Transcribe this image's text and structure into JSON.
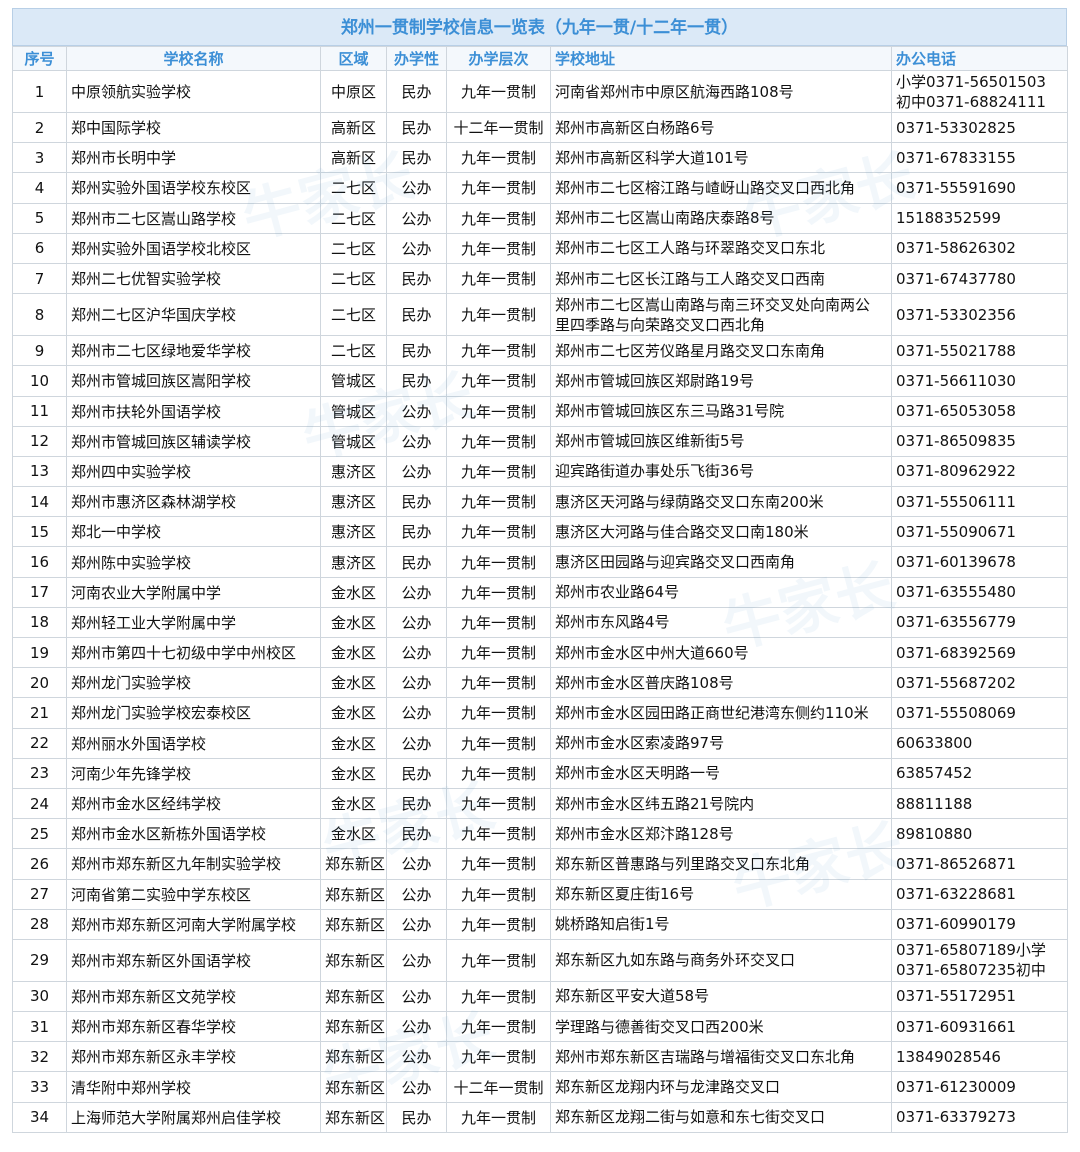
{
  "title": "郑州一贯制学校信息一览表（九年一贯/十二年一贯）",
  "columns": [
    "序号",
    "学校名称",
    "区域",
    "办学性",
    "办学层次",
    "学校地址",
    "办公电话"
  ],
  "rows": [
    {
      "no": "1",
      "name": "中原领航实验学校",
      "district": "中原区",
      "type": "民办",
      "level": "九年一贯制",
      "address": [
        "河南省郑州市中原区航海西路108号"
      ],
      "phone": [
        "小学0371-56501503",
        "初中0371-68824111"
      ]
    },
    {
      "no": "2",
      "name": "郑中国际学校",
      "district": "高新区",
      "type": "民办",
      "level": "十二年一贯制",
      "address": [
        "郑州市高新区白杨路6号"
      ],
      "phone": [
        "0371-53302825"
      ]
    },
    {
      "no": "3",
      "name": "郑州市长明中学",
      "district": "高新区",
      "type": "民办",
      "level": "九年一贯制",
      "address": [
        "郑州市高新区科学大道101号"
      ],
      "phone": [
        "0371-67833155"
      ]
    },
    {
      "no": "4",
      "name": "郑州实验外国语学校东校区",
      "district": "二七区",
      "type": "公办",
      "level": "九年一贯制",
      "address": [
        "郑州市二七区榕江路与嵖岈山路交叉口西北角"
      ],
      "phone": [
        "0371-55591690"
      ]
    },
    {
      "no": "5",
      "name": "郑州市二七区嵩山路学校",
      "district": "二七区",
      "type": "公办",
      "level": "九年一贯制",
      "address": [
        "郑州市二七区嵩山南路庆泰路8号"
      ],
      "phone": [
        "15188352599"
      ]
    },
    {
      "no": "6",
      "name": "郑州实验外国语学校北校区",
      "district": "二七区",
      "type": "公办",
      "level": "九年一贯制",
      "address": [
        "郑州市二七区工人路与环翠路交叉口东北"
      ],
      "phone": [
        "0371-58626302"
      ]
    },
    {
      "no": "7",
      "name": "郑州二七优智实验学校",
      "district": "二七区",
      "type": "民办",
      "level": "九年一贯制",
      "address": [
        "郑州市二七区长江路与工人路交叉口西南"
      ],
      "phone": [
        "0371-67437780"
      ]
    },
    {
      "no": "8",
      "name": "郑州二七区沪华国庆学校",
      "district": "二七区",
      "type": "民办",
      "level": "九年一贯制",
      "address": [
        "郑州市二七区嵩山南路与南三环交叉处向南两公",
        "里四季路与向荣路交叉口西北角"
      ],
      "phone": [
        "0371-53302356"
      ]
    },
    {
      "no": "9",
      "name": "郑州市二七区绿地爱华学校",
      "district": "二七区",
      "type": "民办",
      "level": "九年一贯制",
      "address": [
        "郑州市二七区芳仪路星月路交叉口东南角"
      ],
      "phone": [
        "0371-55021788"
      ]
    },
    {
      "no": "10",
      "name": "郑州市管城回族区嵩阳学校",
      "district": "管城区",
      "type": "民办",
      "level": "九年一贯制",
      "address": [
        "郑州市管城回族区郑尉路19号"
      ],
      "phone": [
        "0371-56611030"
      ]
    },
    {
      "no": "11",
      "name": "郑州市扶轮外国语学校",
      "district": "管城区",
      "type": "公办",
      "level": "九年一贯制",
      "address": [
        "郑州市管城回族区东三马路31号院"
      ],
      "phone": [
        "0371-65053058"
      ]
    },
    {
      "no": "12",
      "name": "郑州市管城回族区辅读学校",
      "district": "管城区",
      "type": "公办",
      "level": "九年一贯制",
      "address": [
        "郑州市管城回族区维新街5号"
      ],
      "phone": [
        "0371-86509835"
      ]
    },
    {
      "no": "13",
      "name": "郑州四中实验学校",
      "district": "惠济区",
      "type": "公办",
      "level": "九年一贯制",
      "address": [
        "迎宾路街道办事处乐飞街36号"
      ],
      "phone": [
        "0371-80962922"
      ]
    },
    {
      "no": "14",
      "name": "郑州市惠济区森林湖学校",
      "district": "惠济区",
      "type": "民办",
      "level": "九年一贯制",
      "address": [
        "惠济区天河路与绿荫路交叉口东南200米"
      ],
      "phone": [
        "0371-55506111"
      ]
    },
    {
      "no": "15",
      "name": "郑北一中学校",
      "district": "惠济区",
      "type": "民办",
      "level": "九年一贯制",
      "address": [
        "惠济区大河路与佳合路交叉口南180米"
      ],
      "phone": [
        "0371-55090671"
      ]
    },
    {
      "no": "16",
      "name": "郑州陈中实验学校",
      "district": "惠济区",
      "type": "民办",
      "level": "九年一贯制",
      "address": [
        "惠济区田园路与迎宾路交叉口西南角"
      ],
      "phone": [
        "0371-60139678"
      ]
    },
    {
      "no": "17",
      "name": "河南农业大学附属中学",
      "district": "金水区",
      "type": "公办",
      "level": "九年一贯制",
      "address": [
        "郑州市农业路64号"
      ],
      "phone": [
        "0371-63555480"
      ]
    },
    {
      "no": "18",
      "name": "郑州轻工业大学附属中学",
      "district": "金水区",
      "type": "公办",
      "level": "九年一贯制",
      "address": [
        "郑州市东风路4号"
      ],
      "phone": [
        "0371-63556779"
      ]
    },
    {
      "no": "19",
      "name": "郑州市第四十七初级中学中州校区",
      "district": "金水区",
      "type": "公办",
      "level": "九年一贯制",
      "address": [
        "郑州市金水区中州大道660号"
      ],
      "phone": [
        "0371-68392569"
      ]
    },
    {
      "no": "20",
      "name": "郑州龙门实验学校",
      "district": "金水区",
      "type": "公办",
      "level": "九年一贯制",
      "address": [
        "郑州市金水区普庆路108号"
      ],
      "phone": [
        "0371-55687202"
      ]
    },
    {
      "no": "21",
      "name": "郑州龙门实验学校宏泰校区",
      "district": "金水区",
      "type": "公办",
      "level": "九年一贯制",
      "address": [
        "郑州市金水区园田路正商世纪港湾东侧约110米"
      ],
      "phone": [
        "0371-55508069"
      ]
    },
    {
      "no": "22",
      "name": "郑州丽水外国语学校",
      "district": "金水区",
      "type": "公办",
      "level": "九年一贯制",
      "address": [
        "郑州市金水区索凌路97号"
      ],
      "phone": [
        "60633800"
      ]
    },
    {
      "no": "23",
      "name": "河南少年先锋学校",
      "district": "金水区",
      "type": "民办",
      "level": "九年一贯制",
      "address": [
        "郑州市金水区天明路一号"
      ],
      "phone": [
        "63857452"
      ]
    },
    {
      "no": "24",
      "name": "郑州市金水区经纬学校",
      "district": "金水区",
      "type": "民办",
      "level": "九年一贯制",
      "address": [
        "郑州市金水区纬五路21号院内"
      ],
      "phone": [
        "88811188"
      ]
    },
    {
      "no": "25",
      "name": "郑州市金水区新栋外国语学校",
      "district": "金水区",
      "type": "民办",
      "level": "九年一贯制",
      "address": [
        "郑州市金水区郑汴路128号"
      ],
      "phone": [
        "89810880"
      ]
    },
    {
      "no": "26",
      "name": "郑州市郑东新区九年制实验学校",
      "district": "郑东新区",
      "type": "公办",
      "level": "九年一贯制",
      "address": [
        "郑东新区普惠路与列里路交叉口东北角"
      ],
      "phone": [
        "0371-86526871"
      ]
    },
    {
      "no": "27",
      "name": "河南省第二实验中学东校区",
      "district": "郑东新区",
      "type": "公办",
      "level": "九年一贯制",
      "address": [
        "郑东新区夏庄街16号"
      ],
      "phone": [
        "0371-63228681"
      ]
    },
    {
      "no": "28",
      "name": "郑州市郑东新区河南大学附属学校",
      "district": "郑东新区",
      "type": "公办",
      "level": "九年一贯制",
      "address": [
        "姚桥路知启街1号"
      ],
      "phone": [
        "0371-60990179"
      ]
    },
    {
      "no": "29",
      "name": "郑州市郑东新区外国语学校",
      "district": "郑东新区",
      "type": "公办",
      "level": "九年一贯制",
      "address": [
        "郑东新区九如东路与商务外环交叉口"
      ],
      "phone": [
        "0371-65807189小学",
        "0371-65807235初中"
      ]
    },
    {
      "no": "30",
      "name": "郑州市郑东新区文苑学校",
      "district": "郑东新区",
      "type": "公办",
      "level": "九年一贯制",
      "address": [
        "郑东新区平安大道58号"
      ],
      "phone": [
        "0371-55172951"
      ]
    },
    {
      "no": "31",
      "name": "郑州市郑东新区春华学校",
      "district": "郑东新区",
      "type": "公办",
      "level": "九年一贯制",
      "address": [
        "学理路与德善街交叉口西200米"
      ],
      "phone": [
        "0371-60931661"
      ]
    },
    {
      "no": "32",
      "name": "郑州市郑东新区永丰学校",
      "district": "郑东新区",
      "type": "公办",
      "level": "九年一贯制",
      "address": [
        "郑州市郑东新区吉瑞路与增福街交叉口东北角"
      ],
      "phone": [
        "13849028546"
      ]
    },
    {
      "no": "33",
      "name": "清华附中郑州学校",
      "district": "郑东新区",
      "type": "公办",
      "level": "十二年一贯制",
      "address": [
        "郑东新区龙翔内环与龙津路交叉口"
      ],
      "phone": [
        "0371-61230009"
      ]
    },
    {
      "no": "34",
      "name": "上海师范大学附属郑州启佳学校",
      "district": "郑东新区",
      "type": "民办",
      "level": "九年一贯制",
      "address": [
        "郑东新区龙翔二街与如意和东七街交叉口"
      ],
      "phone": [
        "0371-63379273"
      ]
    }
  ],
  "watermark": {
    "text": "牛家长",
    "sub": "niujiazhang.com"
  }
}
